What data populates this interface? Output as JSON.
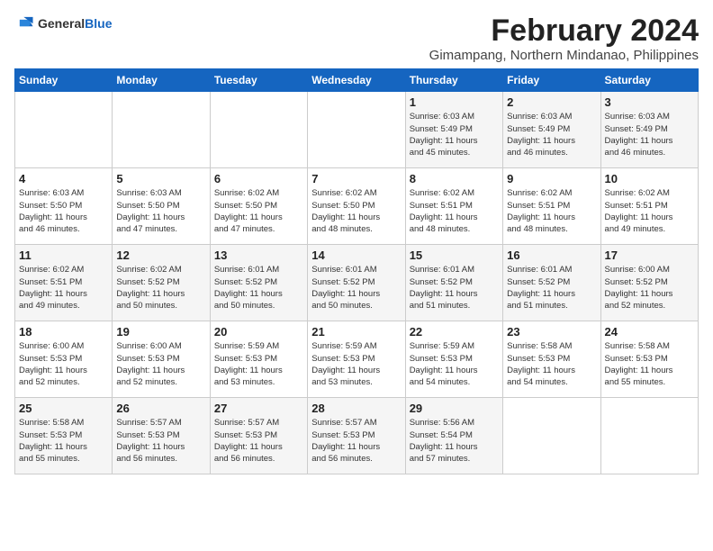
{
  "logo": {
    "general": "General",
    "blue": "Blue"
  },
  "header": {
    "title": "February 2024",
    "subtitle": "Gimampang, Northern Mindanao, Philippines"
  },
  "weekdays": [
    "Sunday",
    "Monday",
    "Tuesday",
    "Wednesday",
    "Thursday",
    "Friday",
    "Saturday"
  ],
  "weeks": [
    [
      {
        "day": "",
        "info": ""
      },
      {
        "day": "",
        "info": ""
      },
      {
        "day": "",
        "info": ""
      },
      {
        "day": "",
        "info": ""
      },
      {
        "day": "1",
        "info": "Sunrise: 6:03 AM\nSunset: 5:49 PM\nDaylight: 11 hours\nand 45 minutes."
      },
      {
        "day": "2",
        "info": "Sunrise: 6:03 AM\nSunset: 5:49 PM\nDaylight: 11 hours\nand 46 minutes."
      },
      {
        "day": "3",
        "info": "Sunrise: 6:03 AM\nSunset: 5:49 PM\nDaylight: 11 hours\nand 46 minutes."
      }
    ],
    [
      {
        "day": "4",
        "info": "Sunrise: 6:03 AM\nSunset: 5:50 PM\nDaylight: 11 hours\nand 46 minutes."
      },
      {
        "day": "5",
        "info": "Sunrise: 6:03 AM\nSunset: 5:50 PM\nDaylight: 11 hours\nand 47 minutes."
      },
      {
        "day": "6",
        "info": "Sunrise: 6:02 AM\nSunset: 5:50 PM\nDaylight: 11 hours\nand 47 minutes."
      },
      {
        "day": "7",
        "info": "Sunrise: 6:02 AM\nSunset: 5:50 PM\nDaylight: 11 hours\nand 48 minutes."
      },
      {
        "day": "8",
        "info": "Sunrise: 6:02 AM\nSunset: 5:51 PM\nDaylight: 11 hours\nand 48 minutes."
      },
      {
        "day": "9",
        "info": "Sunrise: 6:02 AM\nSunset: 5:51 PM\nDaylight: 11 hours\nand 48 minutes."
      },
      {
        "day": "10",
        "info": "Sunrise: 6:02 AM\nSunset: 5:51 PM\nDaylight: 11 hours\nand 49 minutes."
      }
    ],
    [
      {
        "day": "11",
        "info": "Sunrise: 6:02 AM\nSunset: 5:51 PM\nDaylight: 11 hours\nand 49 minutes."
      },
      {
        "day": "12",
        "info": "Sunrise: 6:02 AM\nSunset: 5:52 PM\nDaylight: 11 hours\nand 50 minutes."
      },
      {
        "day": "13",
        "info": "Sunrise: 6:01 AM\nSunset: 5:52 PM\nDaylight: 11 hours\nand 50 minutes."
      },
      {
        "day": "14",
        "info": "Sunrise: 6:01 AM\nSunset: 5:52 PM\nDaylight: 11 hours\nand 50 minutes."
      },
      {
        "day": "15",
        "info": "Sunrise: 6:01 AM\nSunset: 5:52 PM\nDaylight: 11 hours\nand 51 minutes."
      },
      {
        "day": "16",
        "info": "Sunrise: 6:01 AM\nSunset: 5:52 PM\nDaylight: 11 hours\nand 51 minutes."
      },
      {
        "day": "17",
        "info": "Sunrise: 6:00 AM\nSunset: 5:52 PM\nDaylight: 11 hours\nand 52 minutes."
      }
    ],
    [
      {
        "day": "18",
        "info": "Sunrise: 6:00 AM\nSunset: 5:53 PM\nDaylight: 11 hours\nand 52 minutes."
      },
      {
        "day": "19",
        "info": "Sunrise: 6:00 AM\nSunset: 5:53 PM\nDaylight: 11 hours\nand 52 minutes."
      },
      {
        "day": "20",
        "info": "Sunrise: 5:59 AM\nSunset: 5:53 PM\nDaylight: 11 hours\nand 53 minutes."
      },
      {
        "day": "21",
        "info": "Sunrise: 5:59 AM\nSunset: 5:53 PM\nDaylight: 11 hours\nand 53 minutes."
      },
      {
        "day": "22",
        "info": "Sunrise: 5:59 AM\nSunset: 5:53 PM\nDaylight: 11 hours\nand 54 minutes."
      },
      {
        "day": "23",
        "info": "Sunrise: 5:58 AM\nSunset: 5:53 PM\nDaylight: 11 hours\nand 54 minutes."
      },
      {
        "day": "24",
        "info": "Sunrise: 5:58 AM\nSunset: 5:53 PM\nDaylight: 11 hours\nand 55 minutes."
      }
    ],
    [
      {
        "day": "25",
        "info": "Sunrise: 5:58 AM\nSunset: 5:53 PM\nDaylight: 11 hours\nand 55 minutes."
      },
      {
        "day": "26",
        "info": "Sunrise: 5:57 AM\nSunset: 5:53 PM\nDaylight: 11 hours\nand 56 minutes."
      },
      {
        "day": "27",
        "info": "Sunrise: 5:57 AM\nSunset: 5:53 PM\nDaylight: 11 hours\nand 56 minutes."
      },
      {
        "day": "28",
        "info": "Sunrise: 5:57 AM\nSunset: 5:53 PM\nDaylight: 11 hours\nand 56 minutes."
      },
      {
        "day": "29",
        "info": "Sunrise: 5:56 AM\nSunset: 5:54 PM\nDaylight: 11 hours\nand 57 minutes."
      },
      {
        "day": "",
        "info": ""
      },
      {
        "day": "",
        "info": ""
      }
    ]
  ]
}
